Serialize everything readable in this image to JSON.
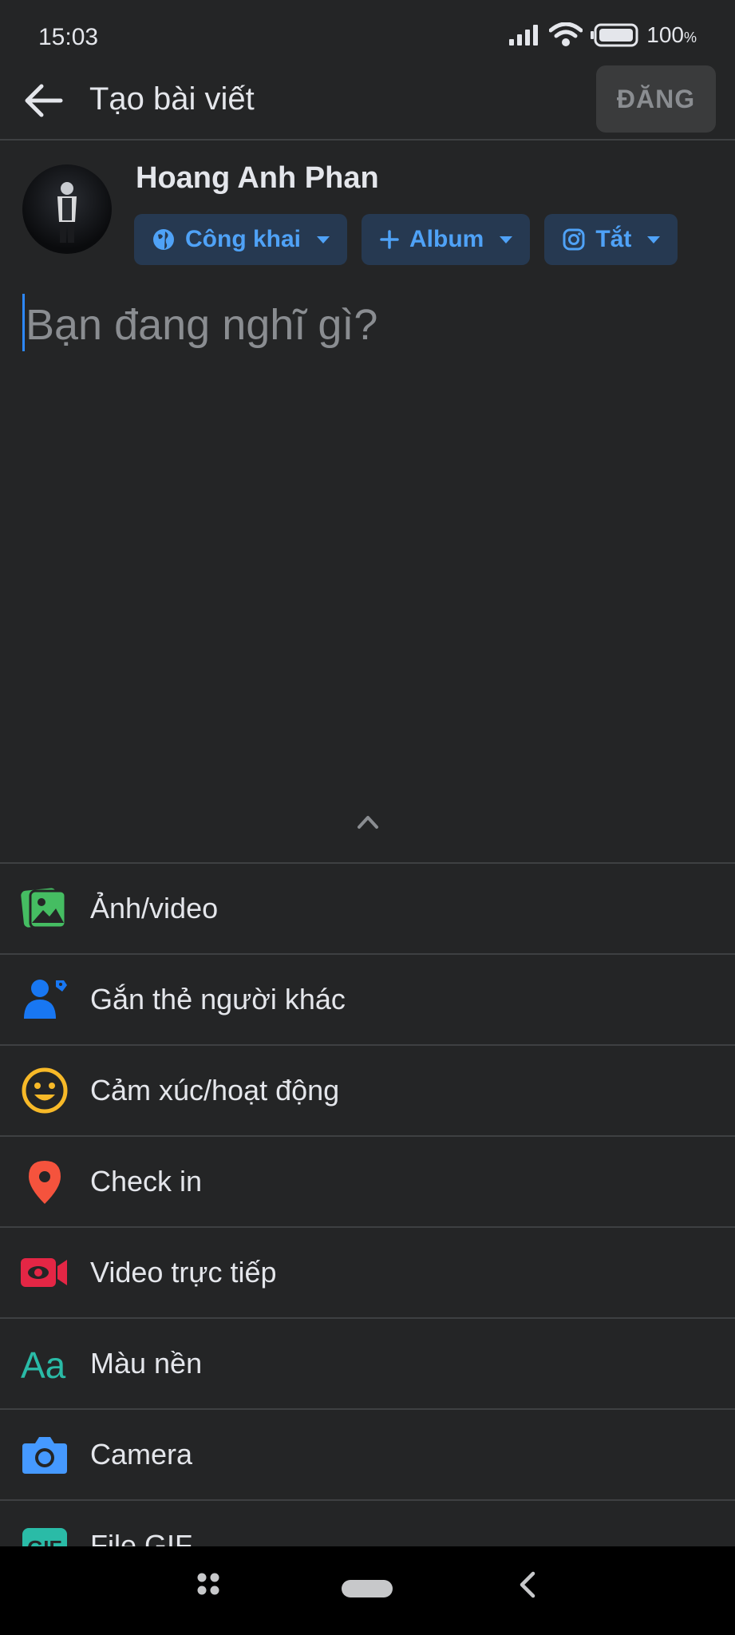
{
  "status_bar": {
    "time": "15:03",
    "battery": "100"
  },
  "header": {
    "title": "Tạo bài viết",
    "post_button": "ĐĂNG"
  },
  "user": {
    "name": "Hoang Anh Phan"
  },
  "chips": {
    "privacy": "Công khai",
    "album": "Album",
    "instagram": "Tắt"
  },
  "composer": {
    "placeholder": "Bạn đang nghĩ gì?"
  },
  "menu": [
    {
      "label": "Ảnh/video",
      "icon": "photo-video-icon",
      "color": "#45bd62"
    },
    {
      "label": "Gắn thẻ người khác",
      "icon": "tag-people-icon",
      "color": "#1877f2"
    },
    {
      "label": "Cảm xúc/hoạt động",
      "icon": "feeling-icon",
      "color": "#f7b928"
    },
    {
      "label": "Check in",
      "icon": "location-pin-icon",
      "color": "#f5533d"
    },
    {
      "label": "Video trực tiếp",
      "icon": "live-video-icon",
      "color": "#e42645"
    },
    {
      "label": "Màu nền",
      "icon": "background-color-icon",
      "color": "#2abba7"
    },
    {
      "label": "Camera",
      "icon": "camera-icon",
      "color": "#4599ff"
    },
    {
      "label": "File GIF",
      "icon": "gif-icon",
      "color": "#2abba7"
    }
  ],
  "colors": {
    "background": "#242526",
    "accent": "#2d88ff",
    "chip_bg": "#263951",
    "chip_text": "#4fa2f7"
  }
}
